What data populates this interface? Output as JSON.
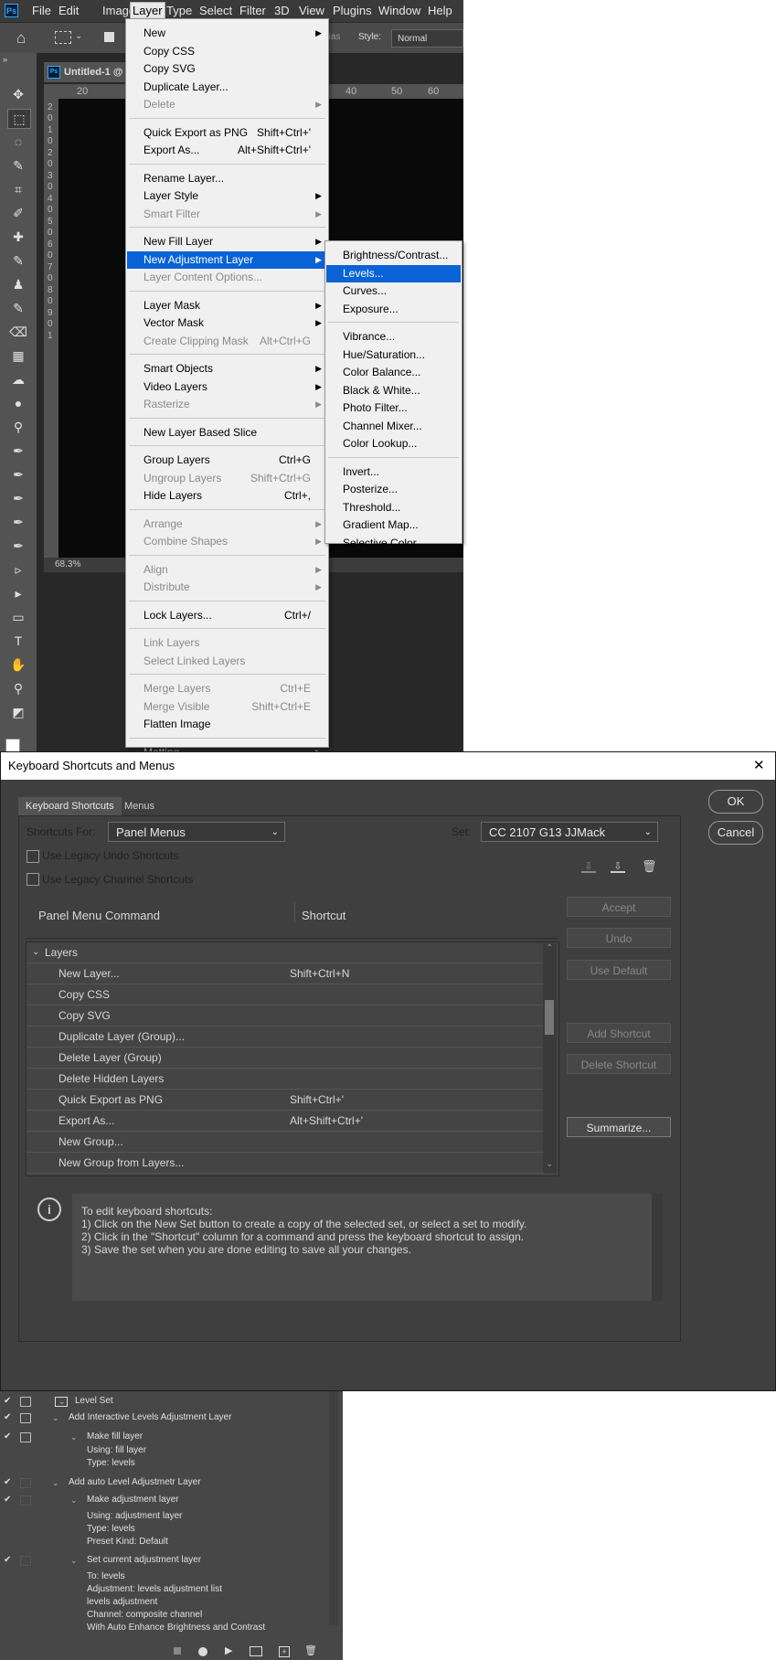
{
  "menubar": [
    "File",
    "Edit",
    "Image",
    "Layer",
    "Type",
    "Select",
    "Filter",
    "3D",
    "View",
    "Plugins",
    "Window",
    "Help"
  ],
  "ps_logo": "Ps",
  "options_bar": {
    "anti_alias": "nti-alias",
    "style_label": "Style:",
    "style_value": "Normal"
  },
  "doc": {
    "tab": "Untitled-1 @",
    "ruler_h": [
      "20",
      "40",
      "50",
      "60"
    ],
    "ruler_v": [
      "2",
      "0",
      "1",
      "0",
      "2",
      "0",
      "3",
      "0",
      "4",
      "0",
      "5",
      "0",
      "6",
      "0",
      "7",
      "0",
      "8",
      "0",
      "9",
      "0",
      "1"
    ],
    "zoom": "68.3%"
  },
  "layer_menu": [
    {
      "label": "New",
      "arrow": true
    },
    {
      "label": "Copy CSS"
    },
    {
      "label": "Copy SVG"
    },
    {
      "label": "Duplicate Layer..."
    },
    {
      "label": "Delete",
      "arrow": true,
      "dis": true
    },
    {
      "sep": true
    },
    {
      "label": "Quick Export as PNG",
      "sc": "Shift+Ctrl+'"
    },
    {
      "label": "Export As...",
      "sc": "Alt+Shift+Ctrl+'"
    },
    {
      "sep": true
    },
    {
      "label": "Rename Layer..."
    },
    {
      "label": "Layer Style",
      "arrow": true
    },
    {
      "label": "Smart Filter",
      "arrow": true,
      "dis": true
    },
    {
      "sep": true
    },
    {
      "label": "New Fill Layer",
      "arrow": true
    },
    {
      "label": "New Adjustment Layer",
      "arrow": true,
      "sel": true
    },
    {
      "label": "Layer Content Options...",
      "dis": true
    },
    {
      "sep": true
    },
    {
      "label": "Layer Mask",
      "arrow": true
    },
    {
      "label": "Vector Mask",
      "arrow": true
    },
    {
      "label": "Create Clipping Mask",
      "sc": "Alt+Ctrl+G",
      "dis": true
    },
    {
      "sep": true
    },
    {
      "label": "Smart Objects",
      "arrow": true
    },
    {
      "label": "Video Layers",
      "arrow": true
    },
    {
      "label": "Rasterize",
      "arrow": true,
      "dis": true
    },
    {
      "sep": true
    },
    {
      "label": "New Layer Based Slice"
    },
    {
      "sep": true
    },
    {
      "label": "Group Layers",
      "sc": "Ctrl+G"
    },
    {
      "label": "Ungroup Layers",
      "sc": "Shift+Ctrl+G",
      "dis": true
    },
    {
      "label": "Hide Layers",
      "sc": "Ctrl+,"
    },
    {
      "sep": true
    },
    {
      "label": "Arrange",
      "arrow": true,
      "dis": true
    },
    {
      "label": "Combine Shapes",
      "arrow": true,
      "dis": true
    },
    {
      "sep": true
    },
    {
      "label": "Align",
      "arrow": true,
      "dis": true
    },
    {
      "label": "Distribute",
      "arrow": true,
      "dis": true
    },
    {
      "sep": true
    },
    {
      "label": "Lock Layers...",
      "sc": "Ctrl+/"
    },
    {
      "sep": true
    },
    {
      "label": "Link Layers",
      "dis": true
    },
    {
      "label": "Select Linked Layers",
      "dis": true
    },
    {
      "sep": true
    },
    {
      "label": "Merge Layers",
      "sc": "Ctrl+E",
      "dis": true
    },
    {
      "label": "Merge Visible",
      "sc": "Shift+Ctrl+E",
      "dis": true
    },
    {
      "label": "Flatten Image"
    },
    {
      "sep": true
    },
    {
      "label": "Matting",
      "arrow": true,
      "dis": true
    }
  ],
  "sub_menu": [
    {
      "label": "Brightness/Contrast..."
    },
    {
      "label": "Levels...",
      "sel": true
    },
    {
      "label": "Curves..."
    },
    {
      "label": "Exposure..."
    },
    {
      "sep": true
    },
    {
      "label": "Vibrance..."
    },
    {
      "label": "Hue/Saturation..."
    },
    {
      "label": "Color Balance..."
    },
    {
      "label": "Black & White..."
    },
    {
      "label": "Photo Filter..."
    },
    {
      "label": "Channel Mixer..."
    },
    {
      "label": "Color Lookup..."
    },
    {
      "sep": true
    },
    {
      "label": "Invert..."
    },
    {
      "label": "Posterize..."
    },
    {
      "label": "Threshold..."
    },
    {
      "label": "Gradient Map..."
    },
    {
      "label": "Selective Color..."
    }
  ],
  "dialog": {
    "title": "Keyboard Shortcuts and Menus",
    "close": "✕",
    "tabs": [
      "Keyboard Shortcuts",
      "Menus"
    ],
    "ok": "OK",
    "cancel": "Cancel",
    "shortcuts_for_label": "Shortcuts For:",
    "shortcuts_for_value": "Panel Menus",
    "set_label": "Set:",
    "set_value": "CC 2107 G13 JJMack",
    "legacy_undo": "Use Legacy Undo Shortcuts",
    "legacy_channel": "Use Legacy Channel Shortcuts",
    "col_command": "Panel Menu Command",
    "col_shortcut": "Shortcut",
    "group": "Layers",
    "rows": [
      {
        "cmd": "New Layer...",
        "sc": "Shift+Ctrl+N"
      },
      {
        "cmd": "Copy CSS",
        "sc": ""
      },
      {
        "cmd": "Copy SVG",
        "sc": ""
      },
      {
        "cmd": "Duplicate Layer (Group)...",
        "sc": ""
      },
      {
        "cmd": "Delete Layer (Group)",
        "sc": ""
      },
      {
        "cmd": "Delete Hidden Layers",
        "sc": ""
      },
      {
        "cmd": "Quick Export as PNG",
        "sc": "Shift+Ctrl+'"
      },
      {
        "cmd": "Export As...",
        "sc": "Alt+Shift+Ctrl+'"
      },
      {
        "cmd": "New Group...",
        "sc": ""
      },
      {
        "cmd": "New Group from Layers...",
        "sc": ""
      }
    ],
    "buttons": [
      {
        "label": "Accept",
        "on": false
      },
      {
        "label": "Undo",
        "on": false
      },
      {
        "label": "Use Default",
        "on": false
      },
      {
        "label": "Add Shortcut",
        "on": false
      },
      {
        "label": "Delete Shortcut",
        "on": false
      },
      {
        "label": "Summarize...",
        "on": true
      }
    ],
    "info_lines": [
      "To edit keyboard shortcuts:",
      "1) Click on the New Set button to create a copy of the selected set, or select a set to modify.",
      "2) Click in the \"Shortcut\" column for a command and press the keyboard shortcut to assign.",
      "3) Save the set when you are done editing to save all your changes."
    ]
  },
  "actions": [
    {
      "text": "Level Set",
      "indent": 82,
      "check": true,
      "dlg": true,
      "folder": true,
      "tw": true
    },
    {
      "text": "Add Interactive Levels Adjustment Layer",
      "indent": 75,
      "check": true,
      "dlg": true,
      "tw": true
    },
    {
      "text": "Make fill layer",
      "indent": 95,
      "check": true,
      "dlg": true,
      "tw": true
    },
    {
      "text": "Using: fill layer",
      "indent": 95
    },
    {
      "text": "Type: levels",
      "indent": 95
    },
    {
      "text": "Add auto Level Adjustmetr Layer",
      "indent": 75,
      "check": true,
      "tw": true
    },
    {
      "text": "Make adjustment layer",
      "indent": 95,
      "check": true,
      "tw": true
    },
    {
      "text": "Using: adjustment layer",
      "indent": 95
    },
    {
      "text": "Type: levels",
      "indent": 95
    },
    {
      "text": "Preset Kind: Default",
      "indent": 95
    },
    {
      "text": "Set current adjustment layer",
      "indent": 95,
      "check": true,
      "tw": true
    },
    {
      "text": "To: levels",
      "indent": 95
    },
    {
      "text": "Adjustment: levels adjustment list",
      "indent": 95
    },
    {
      "text": "levels adjustment",
      "indent": 95
    },
    {
      "text": "Channel: composite channel",
      "indent": 95
    },
    {
      "text": "With Auto Enhance Brightness and Contrast",
      "indent": 95
    }
  ]
}
